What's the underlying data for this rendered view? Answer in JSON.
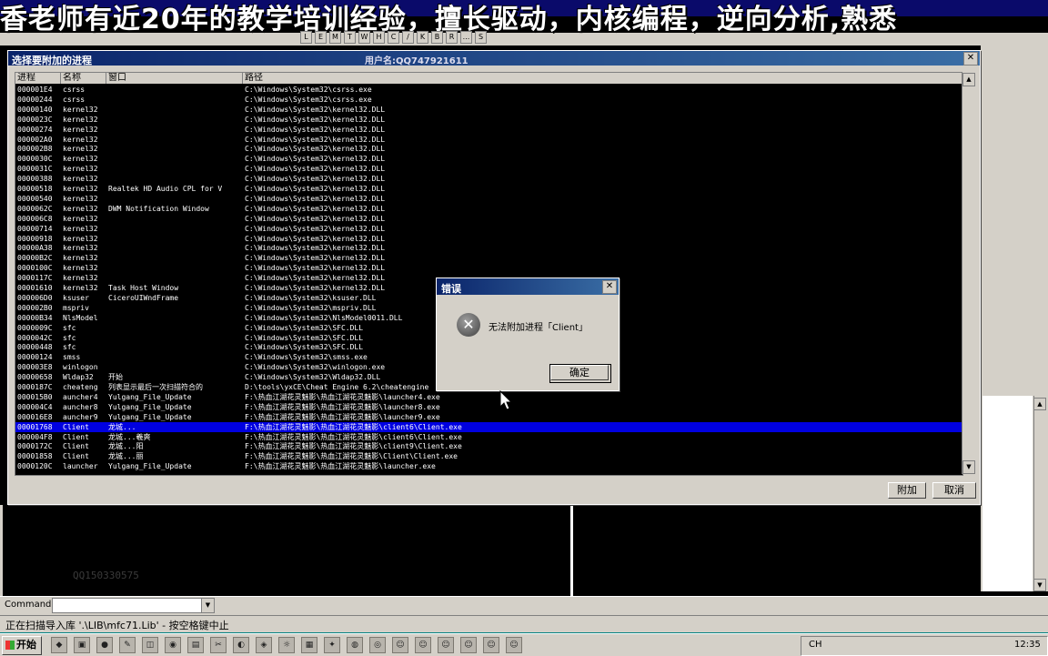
{
  "banner": {
    "text": "香老师有近20年的教学培训经验，擅长驱动，内核编程，逆向分析,熟悉"
  },
  "toolbar": {
    "buttons": [
      "L",
      "E",
      "M",
      "T",
      "W",
      "H",
      "C",
      "/",
      "K",
      "B",
      "R",
      "...",
      "S"
    ]
  },
  "attach_dialog": {
    "title": "选择要附加的进程",
    "user_label": "用户名:QQ747921611",
    "columns": [
      "进程",
      "名称",
      "窗口",
      "路径"
    ],
    "rows": [
      {
        "pid": "000001E4",
        "name": "csrss",
        "window": "",
        "path": "C:\\Windows\\System32\\csrss.exe"
      },
      {
        "pid": "00000244",
        "name": "csrss",
        "window": "",
        "path": "C:\\Windows\\System32\\csrss.exe"
      },
      {
        "pid": "00000140",
        "name": "kernel32",
        "window": "",
        "path": "C:\\Windows\\System32\\kernel32.DLL"
      },
      {
        "pid": "0000023C",
        "name": "kernel32",
        "window": "",
        "path": "C:\\Windows\\System32\\kernel32.DLL"
      },
      {
        "pid": "00000274",
        "name": "kernel32",
        "window": "",
        "path": "C:\\Windows\\System32\\kernel32.DLL"
      },
      {
        "pid": "000002A0",
        "name": "kernel32",
        "window": "",
        "path": "C:\\Windows\\System32\\kernel32.DLL"
      },
      {
        "pid": "000002B8",
        "name": "kernel32",
        "window": "",
        "path": "C:\\Windows\\System32\\kernel32.DLL"
      },
      {
        "pid": "0000030C",
        "name": "kernel32",
        "window": "",
        "path": "C:\\Windows\\System32\\kernel32.DLL"
      },
      {
        "pid": "0000031C",
        "name": "kernel32",
        "window": "",
        "path": "C:\\Windows\\System32\\kernel32.DLL"
      },
      {
        "pid": "00000388",
        "name": "kernel32",
        "window": "",
        "path": "C:\\Windows\\System32\\kernel32.DLL"
      },
      {
        "pid": "00000518",
        "name": "kernel32",
        "window": "Realtek HD Audio CPL for V",
        "path": "C:\\Windows\\System32\\kernel32.DLL"
      },
      {
        "pid": "00000540",
        "name": "kernel32",
        "window": "",
        "path": "C:\\Windows\\System32\\kernel32.DLL"
      },
      {
        "pid": "0000062C",
        "name": "kernel32",
        "window": "DWM Notification Window",
        "path": "C:\\Windows\\System32\\kernel32.DLL"
      },
      {
        "pid": "000006C8",
        "name": "kernel32",
        "window": "",
        "path": "C:\\Windows\\System32\\kernel32.DLL"
      },
      {
        "pid": "00000714",
        "name": "kernel32",
        "window": "",
        "path": "C:\\Windows\\System32\\kernel32.DLL"
      },
      {
        "pid": "00000918",
        "name": "kernel32",
        "window": "",
        "path": "C:\\Windows\\System32\\kernel32.DLL"
      },
      {
        "pid": "00000A38",
        "name": "kernel32",
        "window": "",
        "path": "C:\\Windows\\System32\\kernel32.DLL"
      },
      {
        "pid": "00000B2C",
        "name": "kernel32",
        "window": "",
        "path": "C:\\Windows\\System32\\kernel32.DLL"
      },
      {
        "pid": "0000100C",
        "name": "kernel32",
        "window": "",
        "path": "C:\\Windows\\System32\\kernel32.DLL"
      },
      {
        "pid": "0000117C",
        "name": "kernel32",
        "window": "",
        "path": "C:\\Windows\\System32\\kernel32.DLL"
      },
      {
        "pid": "00001610",
        "name": "kernel32",
        "window": "Task Host Window",
        "path": "C:\\Windows\\System32\\kernel32.DLL"
      },
      {
        "pid": "000006D0",
        "name": "ksuser",
        "window": "CiceroUIWndFrame",
        "path": "C:\\Windows\\System32\\ksuser.DLL"
      },
      {
        "pid": "000002B0",
        "name": "mspriv",
        "window": "",
        "path": "C:\\Windows\\System32\\mspriv.DLL"
      },
      {
        "pid": "00000B34",
        "name": "NlsModel",
        "window": "",
        "path": "C:\\Windows\\System32\\NlsModel0011.DLL"
      },
      {
        "pid": "0000009C",
        "name": "sfc",
        "window": "",
        "path": "C:\\Windows\\System32\\SFC.DLL"
      },
      {
        "pid": "0000042C",
        "name": "sfc",
        "window": "",
        "path": "C:\\Windows\\System32\\SFC.DLL"
      },
      {
        "pid": "00000448",
        "name": "sfc",
        "window": "",
        "path": "C:\\Windows\\System32\\SFC.DLL"
      },
      {
        "pid": "00000124",
        "name": "smss",
        "window": "",
        "path": "C:\\Windows\\System32\\smss.exe"
      },
      {
        "pid": "000003E8",
        "name": "winlogon",
        "window": "",
        "path": "C:\\Windows\\System32\\winlogon.exe"
      },
      {
        "pid": "00000658",
        "name": "Wldap32",
        "window": "开始",
        "path": "C:\\Windows\\System32\\Wldap32.DLL"
      },
      {
        "pid": "0000187C",
        "name": "cheateng",
        "window": "列表显示最后一次扫描符合的",
        "path": "D:\\tools\\yxCE\\Cheat Engine 6.2\\cheatengine"
      },
      {
        "pid": "000015B0",
        "name": "auncher4",
        "window": "Yulgang_File_Update",
        "path": "F:\\热血江湖花灵魅影\\热血江湖花灵魅影\\launcher4.exe"
      },
      {
        "pid": "000004C4",
        "name": "auncher8",
        "window": "Yulgang_File_Update",
        "path": "F:\\热血江湖花灵魅影\\热血江湖花灵魅影\\launcher8.exe"
      },
      {
        "pid": "000016E8",
        "name": "auncher9",
        "window": "Yulgang_File_Update",
        "path": "F:\\热血江湖花灵魅影\\热血江湖花灵魅影\\launcher9.exe"
      },
      {
        "pid": "00001768",
        "name": "Client",
        "window": "龙城...",
        "path": "F:\\热血江湖花灵魅影\\热血江湖花灵魅影\\client6\\Client.exe",
        "selected": true
      },
      {
        "pid": "000004F8",
        "name": "Client",
        "window": "龙城...羲爽",
        "path": "F:\\热血江湖花灵魅影\\热血江湖花灵魅影\\client6\\Client.exe"
      },
      {
        "pid": "0000172C",
        "name": "Client",
        "window": "龙城...阳",
        "path": "F:\\热血江湖花灵魅影\\热血江湖花灵魅影\\client9\\Client.exe"
      },
      {
        "pid": "00001858",
        "name": "Client",
        "window": "龙城...丽",
        "path": "F:\\热血江湖花灵魅影\\热血江湖花灵魅影\\Client\\Client.exe"
      },
      {
        "pid": "0000120C",
        "name": "launcher",
        "window": "Yulgang_File_Update",
        "path": "F:\\热血江湖花灵魅影\\热血江湖花灵魅影\\launcher.exe"
      }
    ],
    "attach_label": "附加",
    "cancel_label": "取消"
  },
  "error_dialog": {
    "title": "错误",
    "message": "无法附加进程「Client」",
    "ok_label": "确定"
  },
  "watermark": "QQ150330575",
  "command": {
    "label": "Command :",
    "value": ""
  },
  "status": {
    "text": "正在扫描导入库 '.\\LIB\\mfc71.Lib' - 按空格键中止"
  },
  "taskbar": {
    "start_label": "开始",
    "tray_lang": "CH",
    "clock": "12:35"
  },
  "colors": {
    "selection": "#0000e0",
    "titlebar": "#0a246a",
    "list_bg": "#000000",
    "list_fg": "#ffffff"
  }
}
